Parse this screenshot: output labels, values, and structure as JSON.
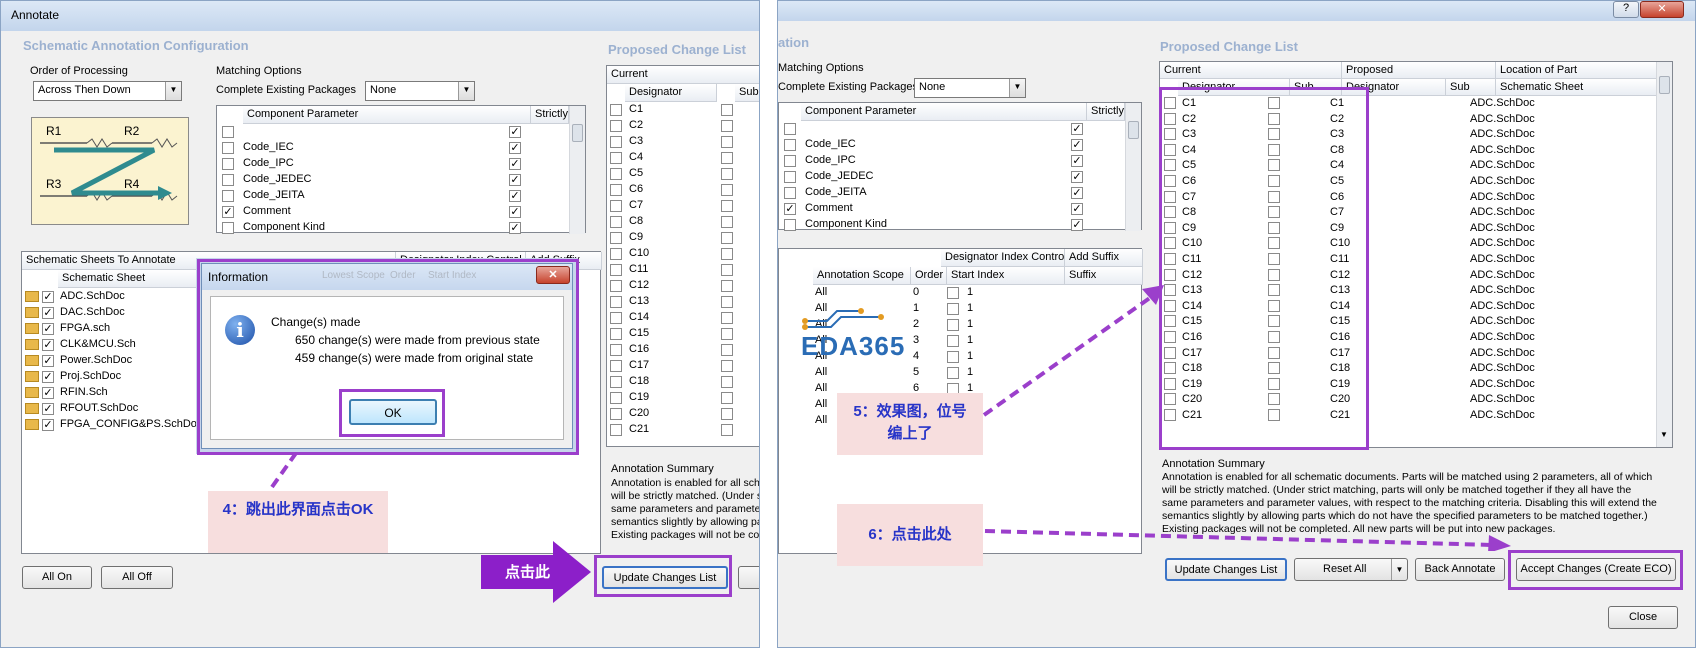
{
  "left": {
    "window_title": "Annotate",
    "config_title": "Schematic Annotation Configuration",
    "proposed_title": "Proposed Change List",
    "order_label": "Order of Processing",
    "order_value": "Across Then Down",
    "diagram_labels": [
      "R1",
      "R2",
      "R3",
      "R4"
    ],
    "matching_label": "Matching Options",
    "complete_pkg_label": "Complete Existing Packages",
    "complete_pkg_value": "None",
    "param_headers": [
      "Component Parameter",
      "Strictly"
    ],
    "params": [
      {
        "name": "",
        "checked": false,
        "strict": true
      },
      {
        "name": "Code_IEC",
        "checked": false,
        "strict": true
      },
      {
        "name": "Code_IPC",
        "checked": false,
        "strict": true
      },
      {
        "name": "Code_JEDEC",
        "checked": false,
        "strict": true
      },
      {
        "name": "Code_JEITA",
        "checked": false,
        "strict": true
      },
      {
        "name": "Comment",
        "checked": true,
        "strict": true
      },
      {
        "name": "Component Kind",
        "checked": false,
        "strict": true
      }
    ],
    "sheets_label": "Schematic Sheets To Annotate",
    "dic_label": "Designator Index Control",
    "add_suffix_label": "Add Suffix",
    "sheet_col": "Schematic Sheet",
    "sheets": [
      "ADC.SchDoc",
      "DAC.SchDoc",
      "FPGA.sch",
      "CLK&MCU.Sch",
      "Power.SchDoc",
      "Proj.SchDoc",
      "RFIN.Sch",
      "RFOUT.SchDoc",
      "FPGA_CONFIG&PS.SchDoc"
    ],
    "current_label": "Current",
    "designator_col": "Designator",
    "sub_col": "Sub",
    "designators": [
      "C1",
      "C2",
      "C3",
      "C4",
      "C5",
      "C6",
      "C7",
      "C8",
      "C9",
      "C10",
      "C11",
      "C12",
      "C13",
      "C14",
      "C15",
      "C16",
      "C17",
      "C18",
      "C19",
      "C20",
      "C21"
    ],
    "summary_title": "Annotation Summary",
    "summary_lines": [
      "Annotation is enabled for all sch",
      "will be strictly matched. (Under s",
      "same parameters and paramete",
      "semantics slightly by allowing pa",
      "Existing packages will not be co"
    ],
    "btn_all_on": "All On",
    "btn_all_off": "All Off",
    "btn_update": "Update Changes List",
    "click_here": "点击此",
    "note4": "4：跳出此界面点击OK"
  },
  "dialog": {
    "title": "Information",
    "heading": "Change(s) made",
    "line1": "650 change(s) were made from previous state",
    "line2": "459 change(s) were made from original state",
    "ok": "OK",
    "bg_cols": [
      "Lowest Scope",
      "Order",
      "Start Index"
    ]
  },
  "right": {
    "partial_title": "ation",
    "matching_label": "Matching Options",
    "complete_pkg_label": "Complete Existing Packages",
    "complete_pkg_value": "None",
    "param_headers": [
      "Component Parameter",
      "Strictly"
    ],
    "params": [
      {
        "name": "",
        "checked": false,
        "strict": true
      },
      {
        "name": "Code_IEC",
        "checked": false,
        "strict": true
      },
      {
        "name": "Code_IPC",
        "checked": false,
        "strict": true
      },
      {
        "name": "Code_JEDEC",
        "checked": false,
        "strict": true
      },
      {
        "name": "Code_JEITA",
        "checked": false,
        "strict": true
      },
      {
        "name": "Comment",
        "checked": true,
        "strict": true
      },
      {
        "name": "Component Kind",
        "checked": false,
        "strict": true
      }
    ],
    "dic_label": "Designator Index Control",
    "add_suffix_label": "Add Suffix",
    "scope_headers": [
      "Annotation Scope",
      "Order",
      "Start Index",
      "Suffix"
    ],
    "scope_rows": [
      {
        "scope": "All",
        "order": "0",
        "start": "1"
      },
      {
        "scope": "All",
        "order": "1",
        "start": "1"
      },
      {
        "scope": "All",
        "order": "2",
        "start": "1"
      },
      {
        "scope": "All",
        "order": "3",
        "start": "1"
      },
      {
        "scope": "All",
        "order": "4",
        "start": "1"
      },
      {
        "scope": "All",
        "order": "5",
        "start": "1"
      },
      {
        "scope": "All",
        "order": "6",
        "start": "1"
      },
      {
        "scope": "All",
        "order": "",
        "start": ""
      },
      {
        "scope": "All",
        "order": "",
        "start": ""
      }
    ],
    "logo_text": "EDA365",
    "proposed_title": "Proposed Change List",
    "current_label": "Current",
    "proposed_label": "Proposed",
    "location_label": "Location of Part",
    "cols": [
      "Designator",
      "Sub",
      "Designator",
      "Sub",
      "Schematic Sheet"
    ],
    "rows": [
      {
        "cur": "C1",
        "prop": "C1",
        "sheet": "ADC.SchDoc"
      },
      {
        "cur": "C2",
        "prop": "C2",
        "sheet": "ADC.SchDoc"
      },
      {
        "cur": "C3",
        "prop": "C3",
        "sheet": "ADC.SchDoc"
      },
      {
        "cur": "C4",
        "prop": "C8",
        "sheet": "ADC.SchDoc"
      },
      {
        "cur": "C5",
        "prop": "C4",
        "sheet": "ADC.SchDoc"
      },
      {
        "cur": "C6",
        "prop": "C5",
        "sheet": "ADC.SchDoc"
      },
      {
        "cur": "C7",
        "prop": "C6",
        "sheet": "ADC.SchDoc"
      },
      {
        "cur": "C8",
        "prop": "C7",
        "sheet": "ADC.SchDoc"
      },
      {
        "cur": "C9",
        "prop": "C9",
        "sheet": "ADC.SchDoc"
      },
      {
        "cur": "C10",
        "prop": "C10",
        "sheet": "ADC.SchDoc"
      },
      {
        "cur": "C11",
        "prop": "C11",
        "sheet": "ADC.SchDoc"
      },
      {
        "cur": "C12",
        "prop": "C12",
        "sheet": "ADC.SchDoc"
      },
      {
        "cur": "C13",
        "prop": "C13",
        "sheet": "ADC.SchDoc"
      },
      {
        "cur": "C14",
        "prop": "C14",
        "sheet": "ADC.SchDoc"
      },
      {
        "cur": "C15",
        "prop": "C15",
        "sheet": "ADC.SchDoc"
      },
      {
        "cur": "C16",
        "prop": "C16",
        "sheet": "ADC.SchDoc"
      },
      {
        "cur": "C17",
        "prop": "C17",
        "sheet": "ADC.SchDoc"
      },
      {
        "cur": "C18",
        "prop": "C18",
        "sheet": "ADC.SchDoc"
      },
      {
        "cur": "C19",
        "prop": "C19",
        "sheet": "ADC.SchDoc"
      },
      {
        "cur": "C20",
        "prop": "C20",
        "sheet": "ADC.SchDoc"
      },
      {
        "cur": "C21",
        "prop": "C21",
        "sheet": "ADC.SchDoc"
      }
    ],
    "summary_title": "Annotation Summary",
    "summary_lines": [
      "Annotation is enabled for all schematic documents. Parts will be matched using 2 parameters, all of which",
      "will be strictly matched. (Under strict matching, parts will only be matched together if they all have the",
      "same parameters and parameter values, with respect to the matching criteria. Disabling this will extend the",
      "semantics slightly by allowing parts which do not have the specified parameters to be matched together.)",
      "Existing packages will not be completed. All new parts will be put into new packages."
    ],
    "btn_update": "Update Changes List",
    "btn_reset": "Reset All",
    "btn_back": "Back Annotate",
    "btn_accept": "Accept Changes (Create ECO)",
    "btn_close": "Close",
    "note5": "5：效果图，位号编上了",
    "note6": "6：点击此处"
  }
}
